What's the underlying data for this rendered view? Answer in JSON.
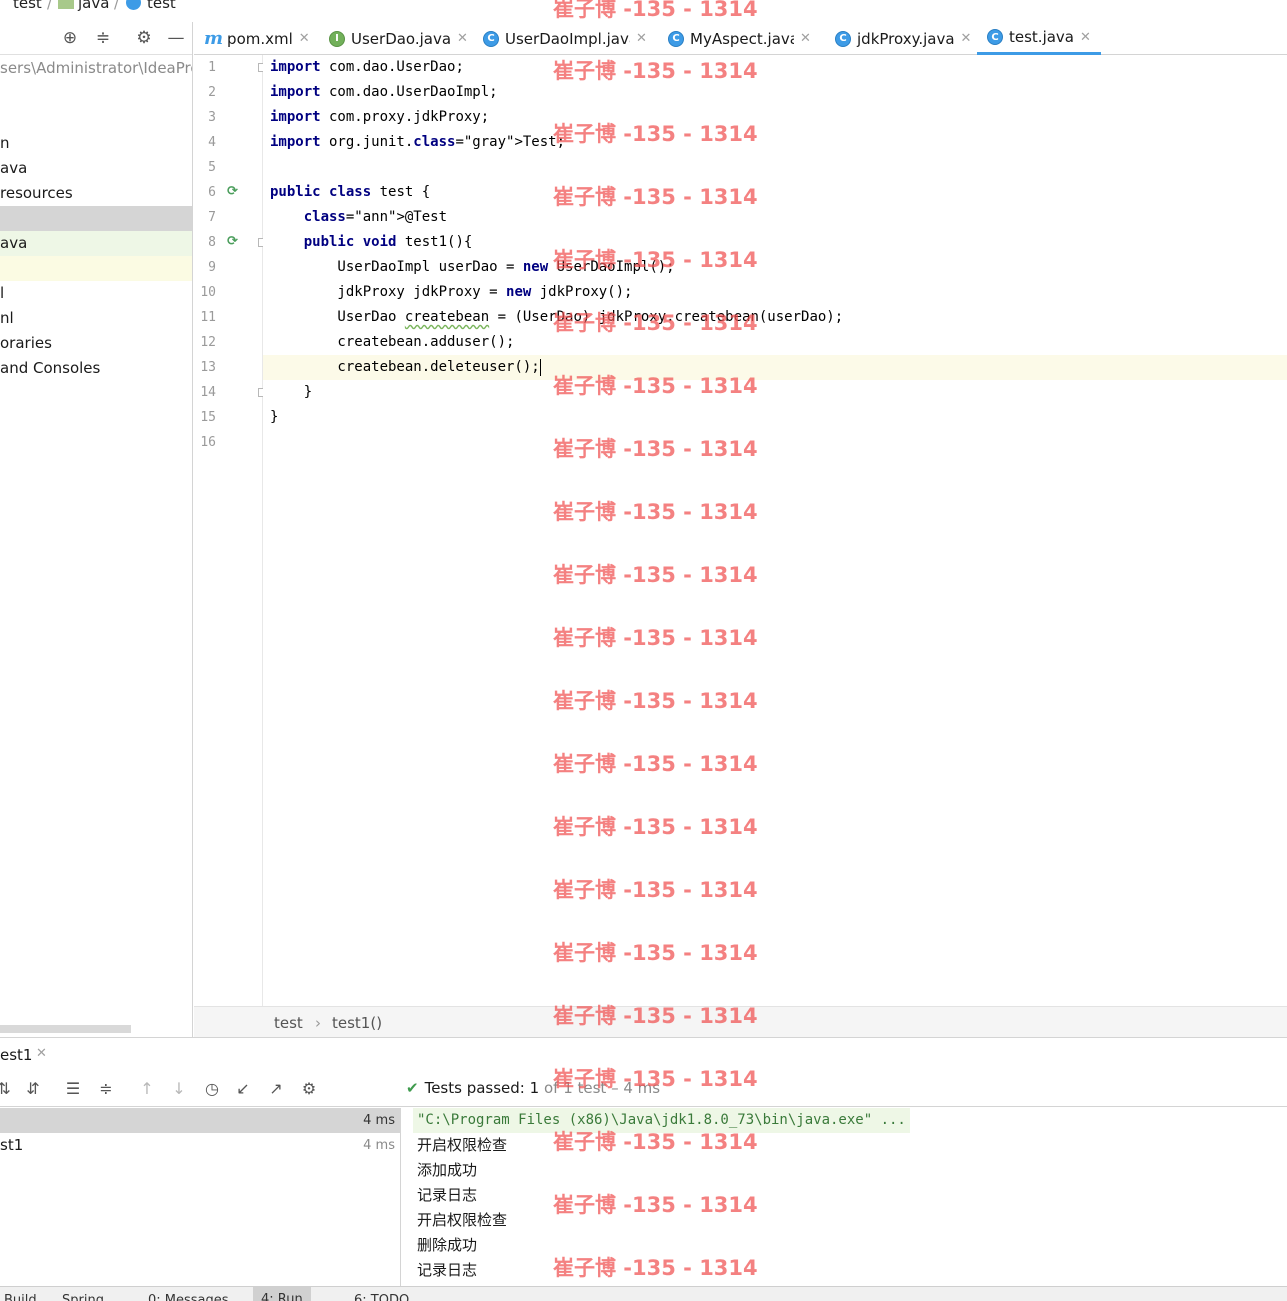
{
  "breadcrumb": {
    "items": [
      "test",
      "java",
      "test"
    ],
    "icons": [
      "none",
      "folder-icon",
      "class-icon"
    ]
  },
  "project_panel": {
    "toolbar_icons": [
      "locate-icon",
      "collapse-all-icon",
      "gear-icon",
      "minimize-icon"
    ],
    "rows": [
      {
        "label": "sers\\Administrator\\IdeaPro",
        "style": "path"
      },
      {
        "label": "",
        "style": ""
      },
      {
        "label": "",
        "style": ""
      },
      {
        "label": "n",
        "style": ""
      },
      {
        "label": "ava",
        "style": ""
      },
      {
        "label": "resources",
        "style": ""
      },
      {
        "label": "",
        "style": "selected"
      },
      {
        "label": "ava",
        "style": "green"
      },
      {
        "label": "",
        "style": "yellow"
      },
      {
        "label": "l",
        "style": ""
      },
      {
        "label": "nl",
        "style": ""
      },
      {
        "label": "oraries",
        "style": ""
      },
      {
        "label": "and Consoles",
        "style": ""
      }
    ]
  },
  "editor_tabs": [
    {
      "label": "pom.xml",
      "icon": "maven-icon",
      "active": false
    },
    {
      "label": "UserDao.java",
      "icon": "interface-icon",
      "active": false
    },
    {
      "label": "UserDaoImpl.java",
      "icon": "class-icon",
      "active": false
    },
    {
      "label": "MyAspect.java",
      "icon": "class-icon",
      "active": false
    },
    {
      "label": "jdkProxy.java",
      "icon": "class-icon",
      "active": false
    },
    {
      "label": "test.java",
      "icon": "test-class-icon",
      "active": true
    }
  ],
  "code": {
    "line_numbers": [
      "1",
      "2",
      "3",
      "4",
      "5",
      "6",
      "7",
      "8",
      "9",
      "10",
      "11",
      "12",
      "13",
      "14",
      "15",
      "16"
    ],
    "current_line": 13,
    "lines": [
      "import com.dao.UserDao;",
      "import com.dao.UserDaoImpl;",
      "import com.proxy.jdkProxy;",
      "import org.junit.Test;",
      "",
      "public class test {",
      "    @Test",
      "    public void test1(){",
      "        UserDaoImpl userDao = new UserDaoImpl();",
      "        jdkProxy jdkProxy = new jdkProxy();",
      "        UserDao createbean = (UserDao) jdkProxy.createbean(userDao);",
      "        createbean.adduser();",
      "        createbean.deleteuser();",
      "    }",
      "}",
      ""
    ]
  },
  "editor_breadcrumb": {
    "items": [
      "test",
      "test1()"
    ],
    "separator": "›"
  },
  "run_panel": {
    "tab_label": "est1",
    "toolbar_icons": [
      "sort-alpha-icon",
      "sort-duration-icon",
      "expand-all-icon",
      "collapse-all-icon",
      "prev-fail-icon",
      "next-fail-icon",
      "history-icon",
      "import-icon",
      "export-icon",
      "gear-icon"
    ],
    "status": {
      "passed_text": "Tests passed:",
      "count": "1",
      "of_text": "of 1 test",
      "time": "4 ms"
    },
    "test_tree": [
      {
        "label": "",
        "time": "4 ms"
      },
      {
        "label": "st1",
        "time": "4 ms"
      }
    ],
    "console": [
      "\"C:\\Program Files (x86)\\Java\\jdk1.8.0_73\\bin\\java.exe\" ...",
      "开启权限检查",
      "添加成功",
      "记录日志",
      "开启权限检查",
      "删除成功",
      "记录日志"
    ]
  },
  "bottom_bar": [
    {
      "label": "Build",
      "active": false
    },
    {
      "label": "Spring",
      "active": false
    },
    {
      "label": "0: Messages",
      "active": false
    },
    {
      "label": "4: Run",
      "active": true
    },
    {
      "label": "6: TODO",
      "active": false
    }
  ],
  "watermark": {
    "text": "崔子博 -135 - 1314",
    "count": 21
  }
}
